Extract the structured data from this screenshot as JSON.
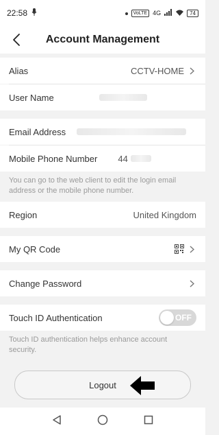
{
  "status": {
    "time": "22:58",
    "network": "VoLTE",
    "signal_label": "4G",
    "battery": "74"
  },
  "header": {
    "title": "Account Management"
  },
  "rows": {
    "alias": {
      "label": "Alias",
      "value": "CCTV-HOME"
    },
    "username": {
      "label": "User Name"
    },
    "email": {
      "label": "Email Address"
    },
    "mobile": {
      "label": "Mobile Phone Number",
      "value": "44"
    },
    "contact_note": "You can go to the web client to edit the login email address or the mobile phone number.",
    "region": {
      "label": "Region",
      "value": "United Kingdom"
    },
    "qr": {
      "label": "My QR Code"
    },
    "password": {
      "label": "Change Password"
    },
    "touchid": {
      "label": "Touch ID Authentication",
      "toggle": "OFF"
    },
    "touchid_note": "Touch ID authentication helps enhance account security."
  },
  "logout_label": "Logout",
  "colors": {
    "background": "#f2f2f2",
    "toggle_off": "#d8d8d8",
    "text": "#222222"
  }
}
